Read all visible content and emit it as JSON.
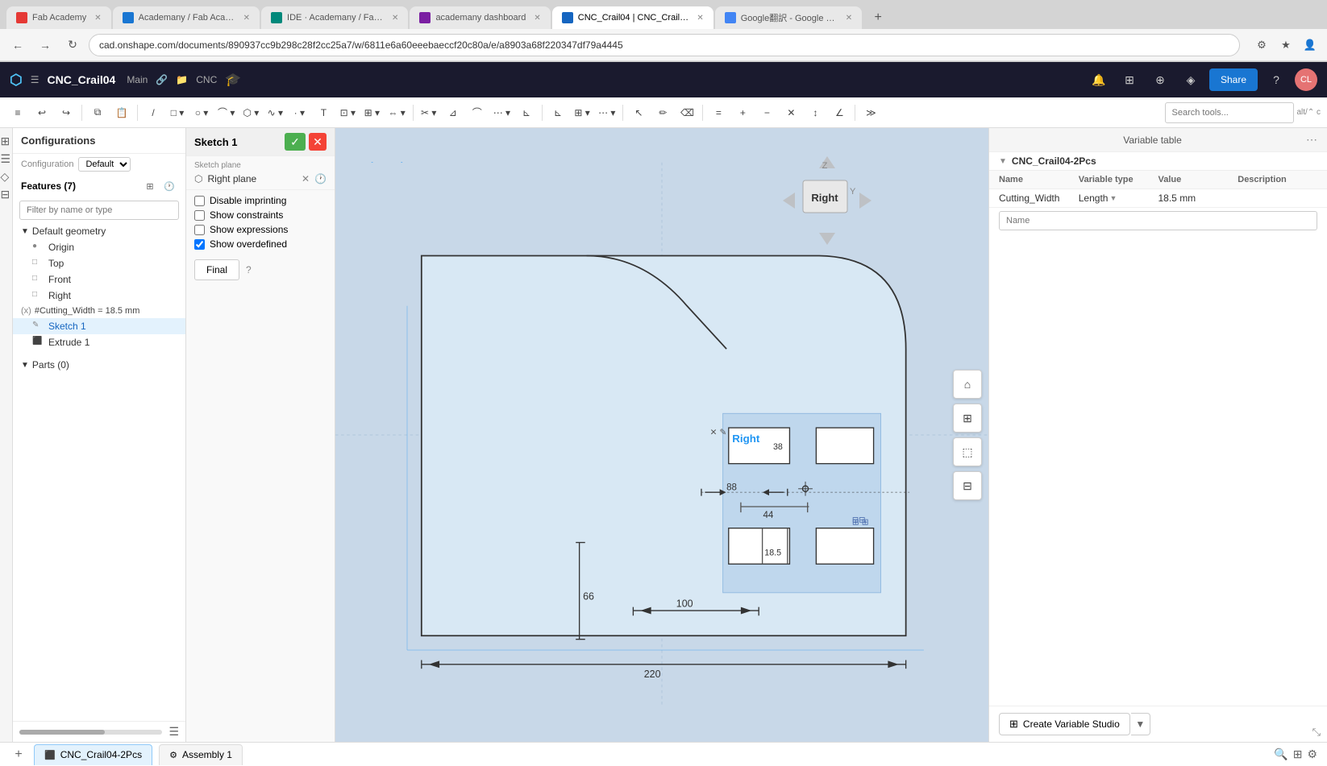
{
  "browser": {
    "tabs": [
      {
        "id": 1,
        "label": "Fab Academy",
        "favicon_color": "#e53935",
        "active": false
      },
      {
        "id": 2,
        "label": "Academany / Fab Academy /...",
        "favicon_color": "#1976d2",
        "active": false
      },
      {
        "id": 3,
        "label": "IDE · Academany / Fab Acad...",
        "favicon_color": "#00897b",
        "active": false
      },
      {
        "id": 4,
        "label": "academany dashboard",
        "favicon_color": "#7b1fa2",
        "active": false
      },
      {
        "id": 5,
        "label": "CNC_Crail04 | CNC_Crail04...",
        "favicon_color": "#1565c0",
        "active": true
      },
      {
        "id": 6,
        "label": "Google翻訳 - Google 搜索",
        "favicon_color": "#4285f4",
        "active": false
      }
    ],
    "url": "cad.onshape.com/documents/890937cc9b298c28f2cc25a7/w/6811e6a60eeebaeccf20c80a/e/a8903a68f220347df79a4445"
  },
  "app_header": {
    "logo": "onshape",
    "doc_name": "CNC_Crail04",
    "branch": "Main",
    "folder": "CNC",
    "share_label": "Share",
    "user": "Crail Lyu"
  },
  "feature_panel": {
    "title": "Configurations",
    "config_label": "Configuration",
    "config_value": "Default",
    "features_title": "Features (7)",
    "filter_placeholder": "Filter by name or type",
    "tree_items": [
      {
        "id": "default-geometry",
        "label": "Default geometry",
        "type": "group",
        "expanded": true
      },
      {
        "id": "origin",
        "label": "Origin",
        "type": "item",
        "icon": "●"
      },
      {
        "id": "top",
        "label": "Top",
        "type": "item",
        "icon": "□"
      },
      {
        "id": "front",
        "label": "Front",
        "type": "item",
        "icon": "□"
      },
      {
        "id": "right",
        "label": "Right",
        "type": "item",
        "icon": "□"
      }
    ],
    "param_item": "#Cutting_Width = 18.5 mm",
    "sketch1_label": "Sketch 1",
    "extrude1_label": "Extrude 1",
    "parts_title": "Parts (0)"
  },
  "sketch_panel": {
    "title": "Sketch 1",
    "ok_icon": "✓",
    "cancel_icon": "✕",
    "plane_label": "Sketch plane",
    "plane_value": "Right plane",
    "disable_imprinting": "Disable imprinting",
    "show_constraints": "Show constraints",
    "show_expressions": "Show expressions",
    "show_overdefined": "Show overdefined",
    "show_overdefined_checked": true,
    "final_btn": "Final",
    "help_icon": "?"
  },
  "canvas": {
    "sketch_label": "Sketch 1",
    "right_view_label": "Right",
    "dimension_88": "88",
    "dimension_44": "44",
    "dimension_18_5": "18.5",
    "dimension_100": "100",
    "dimension_66": "66",
    "dimension_220": "220",
    "dimension_38": "38"
  },
  "view_cube": {
    "label": "Right"
  },
  "variable_table": {
    "title": "Variable table",
    "doc_name": "CNC_Crail04-2Pcs",
    "col_name": "Name",
    "col_type": "Variable type",
    "col_value": "Value",
    "col_desc": "Description",
    "rows": [
      {
        "name": "Cutting_Width",
        "type": "Length",
        "value": "18.5 mm",
        "desc": ""
      }
    ],
    "new_row_placeholder": "Name",
    "create_btn": "Create Variable Studio"
  },
  "bottom_bar": {
    "tab1": "CNC_Crail04-2Pcs",
    "tab2": "Assembly 1"
  }
}
